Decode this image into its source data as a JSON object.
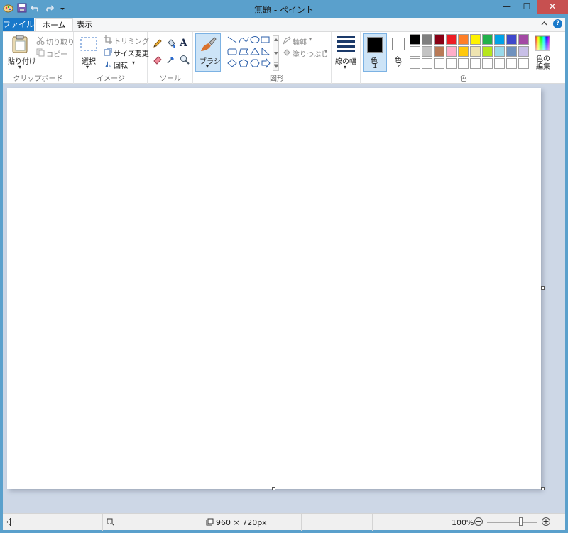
{
  "window": {
    "title": "無題 - ペイント",
    "controls": {
      "minimize": "—",
      "maximize": "☐",
      "close": "✕"
    }
  },
  "qat": {
    "icons": [
      "paint-app-icon",
      "save-icon",
      "undo-icon",
      "redo-icon",
      "customize-qat-icon"
    ]
  },
  "tabs": {
    "file": "ファイル",
    "home": "ホーム",
    "view": "表示"
  },
  "ribbon": {
    "clipboard": {
      "label": "クリップボード",
      "paste": "貼り付け",
      "cut": "切り取り",
      "copy": "コピー"
    },
    "image": {
      "label": "イメージ",
      "select": "選択",
      "crop": "トリミング",
      "resize": "サイズ変更",
      "rotate": "回転"
    },
    "tools": {
      "label": "ツール",
      "font_glyph": "A"
    },
    "brush": {
      "label": "ブラシ"
    },
    "shapes": {
      "label": "図形",
      "outline": "輪郭",
      "fill": "塗りつぶし"
    },
    "size": {
      "label": "線の幅"
    },
    "color1": {
      "label": "色",
      "number": "1",
      "value": "#000000"
    },
    "color2": {
      "label": "色",
      "number": "2",
      "value": "#ffffff"
    },
    "colors": {
      "label": "色",
      "edit": "色の編集",
      "row1": [
        "#000000",
        "#7f7f7f",
        "#880015",
        "#ed1c24",
        "#ff7f27",
        "#fff200",
        "#22b14c",
        "#00a2e8",
        "#3f48cc",
        "#a349a4"
      ],
      "row2": [
        "#ffffff",
        "#c3c3c3",
        "#b97a57",
        "#ffaec9",
        "#ffc90e",
        "#efe4b0",
        "#b5e61d",
        "#99d9ea",
        "#7092be",
        "#c8bfe7"
      ],
      "row3": [
        "#ffffff",
        "#ffffff",
        "#ffffff",
        "#ffffff",
        "#ffffff",
        "#ffffff",
        "#ffffff",
        "#ffffff",
        "#ffffff",
        "#ffffff"
      ]
    }
  },
  "statusbar": {
    "canvas_size": "960 × 720px",
    "zoom": "100%",
    "zoom_level": 1.0,
    "zoom_out": "−",
    "zoom_in": "+"
  }
}
